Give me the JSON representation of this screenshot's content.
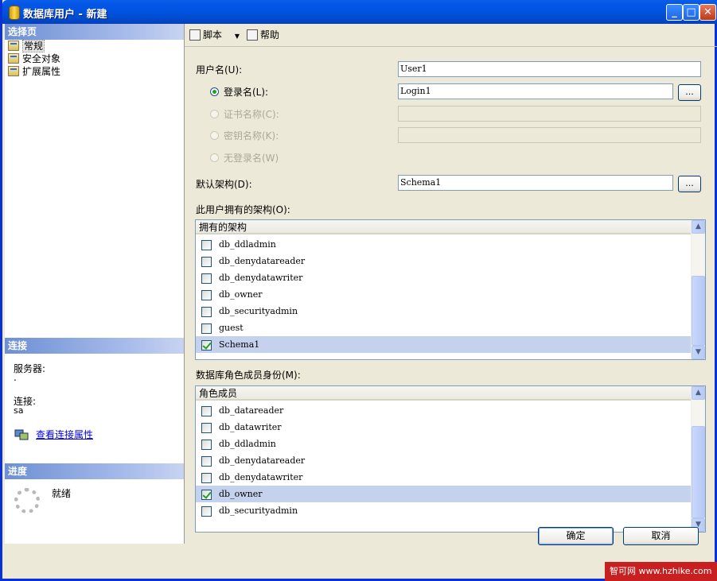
{
  "window": {
    "title": "数据库用户 - 新建"
  },
  "left": {
    "select_page_header": "选择页",
    "pages": [
      {
        "label": "常规",
        "selected": true
      },
      {
        "label": "安全对象",
        "selected": false
      },
      {
        "label": "扩展属性",
        "selected": false
      }
    ],
    "connection_header": "连接",
    "server_label": "服务器:",
    "server_value": ".",
    "connection_label": "连接:",
    "connection_value": "sa",
    "view_connection_props": "查看连接属性",
    "progress_header": "进度",
    "progress_status": "就绪"
  },
  "toolbar": {
    "script_label": "脚本",
    "help_label": "帮助"
  },
  "form": {
    "username_label": "用户名(U):",
    "username_value": "User1",
    "login_name_label": "登录名(L):",
    "login_name_value": "Login1",
    "cert_name_label": "证书名称(C):",
    "key_name_label": "密钥名称(K):",
    "no_login_label": "无登录名(W)",
    "default_schema_label": "默认架构(D):",
    "default_schema_value": "Schema1",
    "browse_label": "...",
    "owned_schemas_label": "此用户拥有的架构(O):",
    "owned_schemas_header": "拥有的架构",
    "owned_schemas": [
      {
        "name": "db_ddladmin",
        "checked": false
      },
      {
        "name": "db_denydatareader",
        "checked": false
      },
      {
        "name": "db_denydatawriter",
        "checked": false
      },
      {
        "name": "db_owner",
        "checked": false
      },
      {
        "name": "db_securityadmin",
        "checked": false
      },
      {
        "name": "guest",
        "checked": false
      },
      {
        "name": "Schema1",
        "checked": true
      }
    ],
    "role_membership_label": "数据库角色成员身份(M):",
    "role_membership_header": "角色成员",
    "roles": [
      {
        "name": "db_datareader",
        "checked": false
      },
      {
        "name": "db_datawriter",
        "checked": false
      },
      {
        "name": "db_ddladmin",
        "checked": false
      },
      {
        "name": "db_denydatareader",
        "checked": false
      },
      {
        "name": "db_denydatawriter",
        "checked": false
      },
      {
        "name": "db_owner",
        "checked": true
      },
      {
        "name": "db_securityadmin",
        "checked": false
      }
    ]
  },
  "footer": {
    "ok_label": "确定",
    "cancel_label": "取消"
  },
  "watermark": {
    "text": "智可网 www.hzhike.com"
  }
}
